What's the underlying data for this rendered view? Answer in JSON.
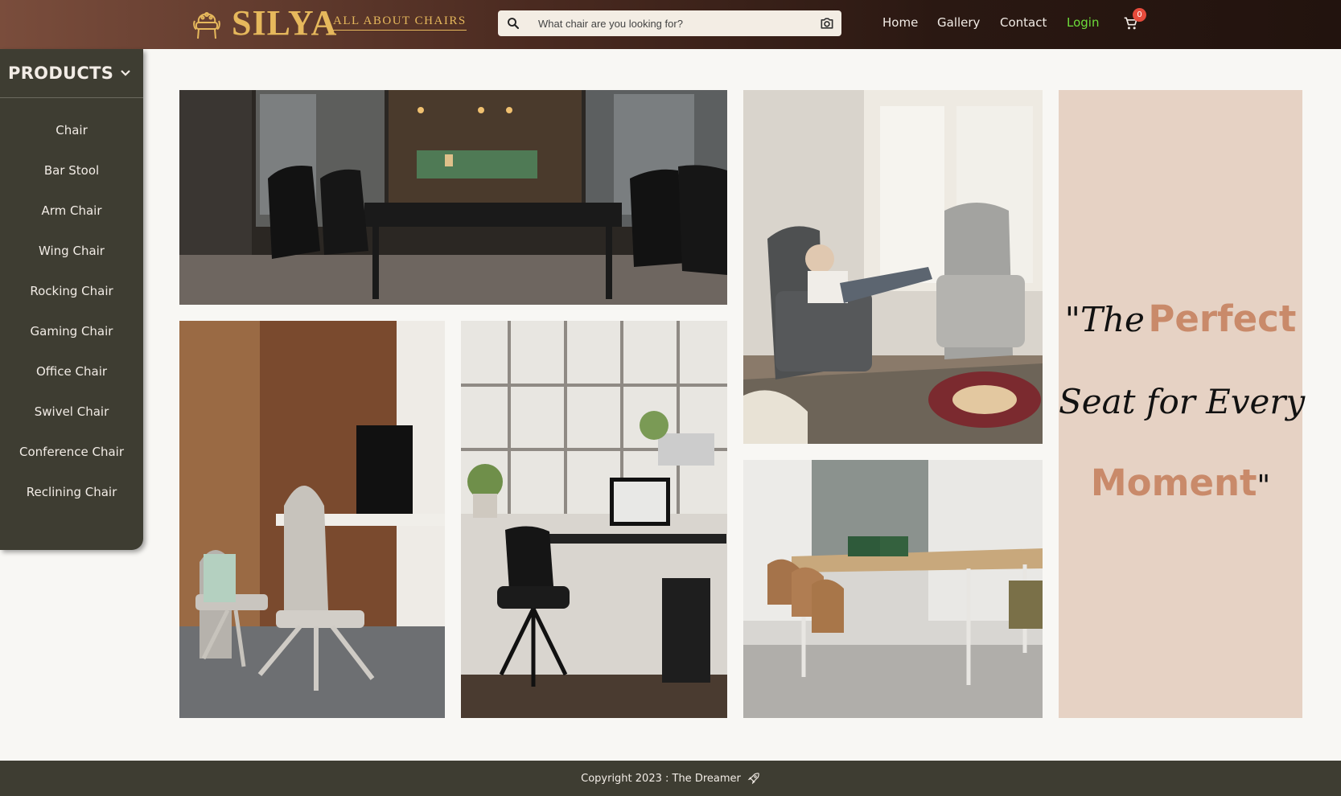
{
  "header": {
    "brand": "SILYA",
    "tagline": "ALL ABOUT CHAIRS",
    "search_placeholder": "What chair are you looking for?",
    "nav": [
      "Home",
      "Gallery",
      "Contact",
      "Login"
    ],
    "cart_count": "0",
    "login_color": "#6ddc3a",
    "brand_color": "#e6b85c"
  },
  "sidebar": {
    "title": "PRODUCTS",
    "items": [
      "Chair",
      "Bar Stool",
      "Arm Chair",
      "Wing Chair",
      "Rocking Chair",
      "Gaming Chair",
      "Office Chair",
      "Swivel Chair",
      "Conference Chair",
      "Reclining Chair"
    ]
  },
  "gallery": {
    "images": [
      "office-conference-photo",
      "child-armchair-photo",
      "ergonomic-chairs-photo",
      "home-office-desk-photo",
      "meeting-room-photo"
    ]
  },
  "quote": {
    "open": "\"The",
    "perfect": "Perfect",
    "middle": "Seat for Every",
    "moment": "Moment",
    "close": "\"",
    "accent_color": "#c98a6a",
    "bg_color": "#e6d2c4"
  },
  "footer": {
    "copyright": "Copyright 2023 : The Dreamer"
  }
}
